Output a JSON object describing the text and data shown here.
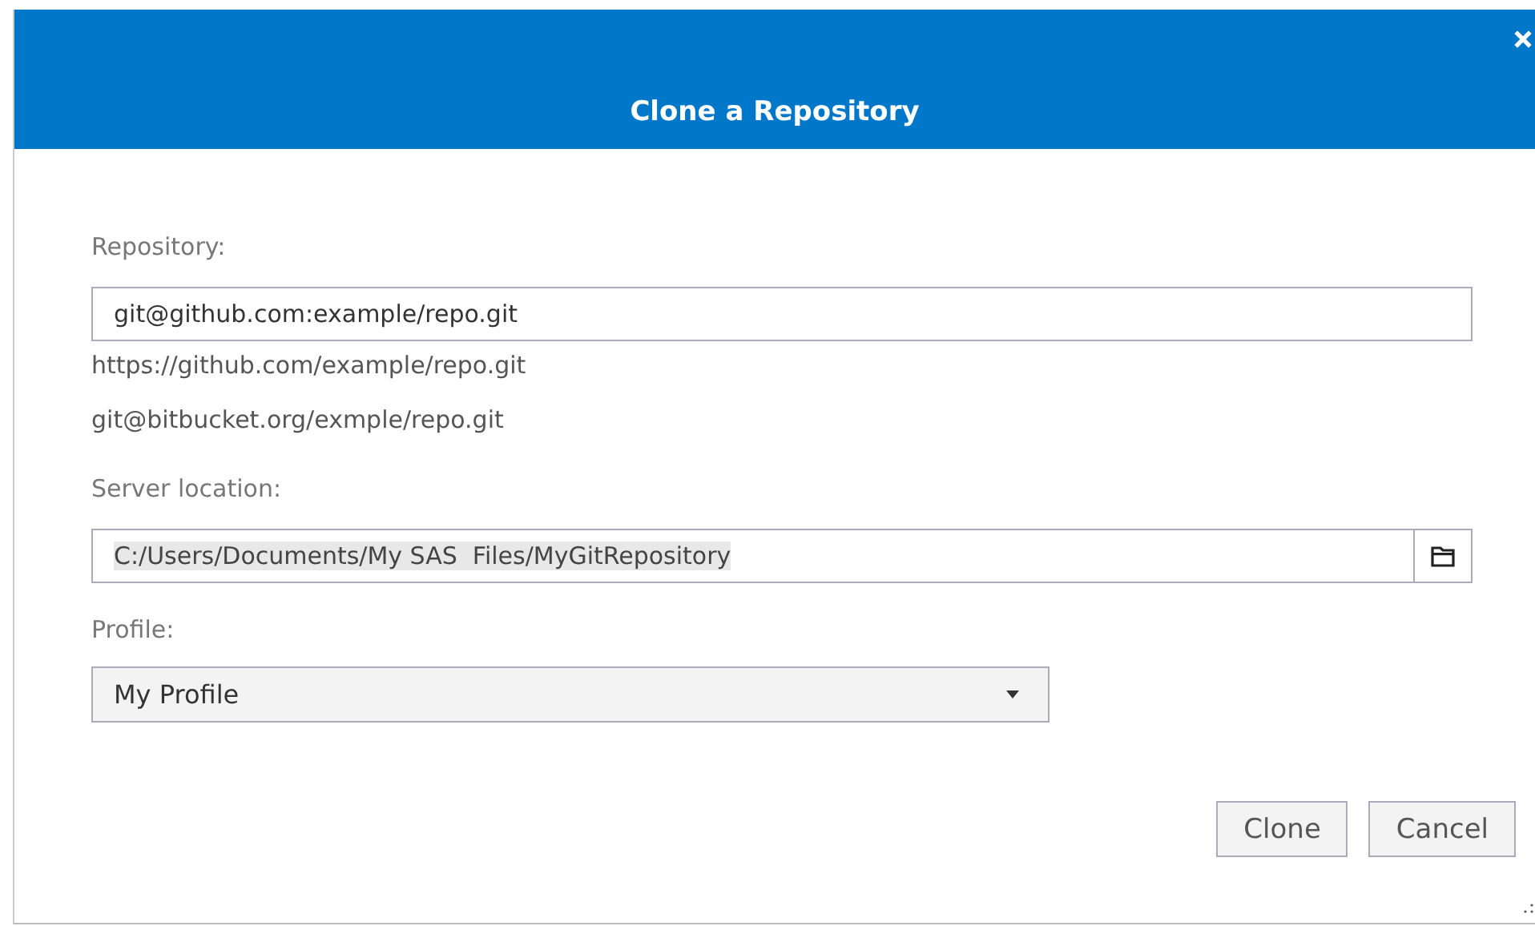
{
  "dialog": {
    "title": "Clone a Repository"
  },
  "repository": {
    "label": "Repository:",
    "value": "git@github.com:example/repo.git",
    "suggestions": [
      "https://github.com/example/repo.git",
      "git@bitbucket.org/exmple/repo.git"
    ]
  },
  "server_location": {
    "label": "Server location:",
    "value": "C:/Users/Documents/My SAS  Files/MyGitRepository"
  },
  "profile": {
    "label": "Profile:",
    "value": "My Profile"
  },
  "buttons": [
    "Clone",
    "Cancel"
  ]
}
